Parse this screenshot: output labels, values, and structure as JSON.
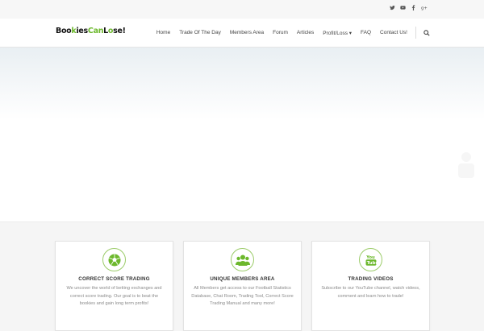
{
  "social": {
    "twitter": "🐦",
    "youtube": "▶",
    "facebook": "f",
    "googleplus": "g+"
  },
  "logo": {
    "part1": "Boo",
    "part1b": "ies",
    "part2": "Can",
    "part3": "L",
    "part3b": "se!"
  },
  "nav": {
    "items": [
      {
        "label": "Home"
      },
      {
        "label": "Trade Of The Day"
      },
      {
        "label": "Members Area"
      },
      {
        "label": "Forum"
      },
      {
        "label": "Articles"
      },
      {
        "label": "Profit/Loss ▾"
      },
      {
        "label": "FAQ"
      },
      {
        "label": "Contact Us!"
      }
    ]
  },
  "features": [
    {
      "icon": "soccer-ball-icon",
      "title": "CORRECT SCORE TRADING",
      "desc": "We uncover the world of betting exchanges and correct score trading. Our goal is to beat the bookies and gain long term profits!"
    },
    {
      "icon": "group-icon",
      "title": "UNIQUE MEMBERS AREA",
      "desc": "All Members get access to our Football Statistics Database, Chat Room, Trading Tool, Correct Score Trading Manual and many more!"
    },
    {
      "icon": "youtube-icon",
      "title": "TRADING VIDEOS",
      "desc": "Subscribe to our YouTube channel, watch videos, comment and learn how to trade!"
    }
  ],
  "colors": {
    "brand_green": "#6cb82c",
    "hero_top": "#e9eff3"
  }
}
